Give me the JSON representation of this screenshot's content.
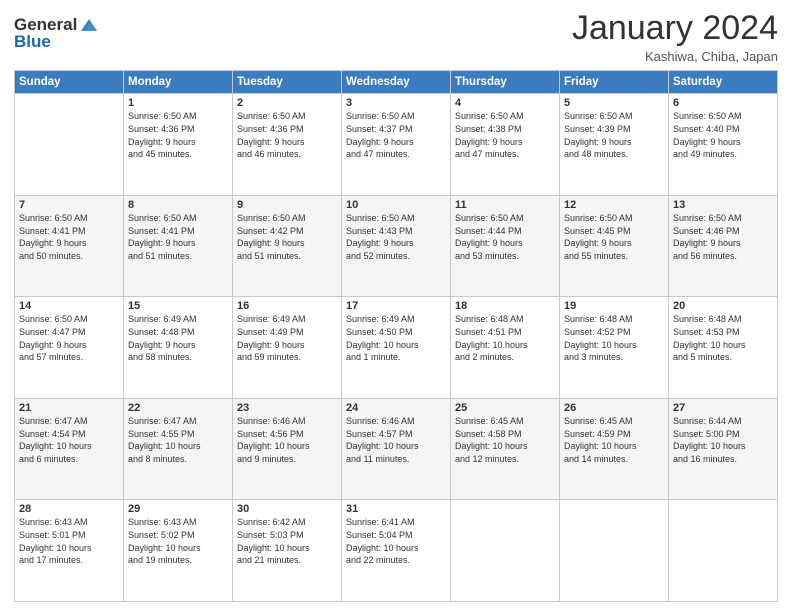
{
  "header": {
    "logo": {
      "general": "General",
      "blue": "Blue"
    },
    "title": "January 2024",
    "location": "Kashiwa, Chiba, Japan"
  },
  "days_of_week": [
    "Sunday",
    "Monday",
    "Tuesday",
    "Wednesday",
    "Thursday",
    "Friday",
    "Saturday"
  ],
  "weeks": [
    [
      {
        "day": "",
        "info": ""
      },
      {
        "day": "1",
        "info": "Sunrise: 6:50 AM\nSunset: 4:36 PM\nDaylight: 9 hours\nand 45 minutes."
      },
      {
        "day": "2",
        "info": "Sunrise: 6:50 AM\nSunset: 4:36 PM\nDaylight: 9 hours\nand 46 minutes."
      },
      {
        "day": "3",
        "info": "Sunrise: 6:50 AM\nSunset: 4:37 PM\nDaylight: 9 hours\nand 47 minutes."
      },
      {
        "day": "4",
        "info": "Sunrise: 6:50 AM\nSunset: 4:38 PM\nDaylight: 9 hours\nand 47 minutes."
      },
      {
        "day": "5",
        "info": "Sunrise: 6:50 AM\nSunset: 4:39 PM\nDaylight: 9 hours\nand 48 minutes."
      },
      {
        "day": "6",
        "info": "Sunrise: 6:50 AM\nSunset: 4:40 PM\nDaylight: 9 hours\nand 49 minutes."
      }
    ],
    [
      {
        "day": "7",
        "info": ""
      },
      {
        "day": "8",
        "info": "Sunrise: 6:50 AM\nSunset: 4:41 PM\nDaylight: 9 hours\nand 51 minutes."
      },
      {
        "day": "9",
        "info": "Sunrise: 6:50 AM\nSunset: 4:42 PM\nDaylight: 9 hours\nand 51 minutes."
      },
      {
        "day": "10",
        "info": "Sunrise: 6:50 AM\nSunset: 4:43 PM\nDaylight: 9 hours\nand 52 minutes."
      },
      {
        "day": "11",
        "info": "Sunrise: 6:50 AM\nSunset: 4:44 PM\nDaylight: 9 hours\nand 53 minutes."
      },
      {
        "day": "12",
        "info": "Sunrise: 6:50 AM\nSunset: 4:45 PM\nDaylight: 9 hours\nand 55 minutes."
      },
      {
        "day": "13",
        "info": "Sunrise: 6:50 AM\nSunset: 4:46 PM\nDaylight: 9 hours\nand 56 minutes."
      }
    ],
    [
      {
        "day": "14",
        "info": ""
      },
      {
        "day": "15",
        "info": "Sunrise: 6:49 AM\nSunset: 4:48 PM\nDaylight: 9 hours\nand 58 minutes."
      },
      {
        "day": "16",
        "info": "Sunrise: 6:49 AM\nSunset: 4:49 PM\nDaylight: 9 hours\nand 59 minutes."
      },
      {
        "day": "17",
        "info": "Sunrise: 6:49 AM\nSunset: 4:50 PM\nDaylight: 10 hours\nand 1 minute."
      },
      {
        "day": "18",
        "info": "Sunrise: 6:48 AM\nSunset: 4:51 PM\nDaylight: 10 hours\nand 2 minutes."
      },
      {
        "day": "19",
        "info": "Sunrise: 6:48 AM\nSunset: 4:52 PM\nDaylight: 10 hours\nand 3 minutes."
      },
      {
        "day": "20",
        "info": "Sunrise: 6:48 AM\nSunset: 4:53 PM\nDaylight: 10 hours\nand 5 minutes."
      }
    ],
    [
      {
        "day": "21",
        "info": ""
      },
      {
        "day": "22",
        "info": "Sunrise: 6:47 AM\nSunset: 4:55 PM\nDaylight: 10 hours\nand 8 minutes."
      },
      {
        "day": "23",
        "info": "Sunrise: 6:46 AM\nSunset: 4:56 PM\nDaylight: 10 hours\nand 9 minutes."
      },
      {
        "day": "24",
        "info": "Sunrise: 6:46 AM\nSunset: 4:57 PM\nDaylight: 10 hours\nand 11 minutes."
      },
      {
        "day": "25",
        "info": "Sunrise: 6:45 AM\nSunset: 4:58 PM\nDaylight: 10 hours\nand 12 minutes."
      },
      {
        "day": "26",
        "info": "Sunrise: 6:45 AM\nSunset: 4:59 PM\nDaylight: 10 hours\nand 14 minutes."
      },
      {
        "day": "27",
        "info": "Sunrise: 6:44 AM\nSunset: 5:00 PM\nDaylight: 10 hours\nand 16 minutes."
      }
    ],
    [
      {
        "day": "28",
        "info": ""
      },
      {
        "day": "29",
        "info": "Sunrise: 6:43 AM\nSunset: 5:02 PM\nDaylight: 10 hours\nand 19 minutes."
      },
      {
        "day": "30",
        "info": "Sunrise: 6:42 AM\nSunset: 5:03 PM\nDaylight: 10 hours\nand 21 minutes."
      },
      {
        "day": "31",
        "info": "Sunrise: 6:41 AM\nSunset: 5:04 PM\nDaylight: 10 hours\nand 22 minutes."
      },
      {
        "day": "",
        "info": ""
      },
      {
        "day": "",
        "info": ""
      },
      {
        "day": "",
        "info": ""
      }
    ]
  ],
  "week1_day7_info": "Sunrise: 6:50 AM\nSunset: 4:41 PM\nDaylight: 9 hours\nand 50 minutes.",
  "week2_day1_info": "Sunrise: 6:50 AM\nSunset: 4:47 PM\nDaylight: 9 hours\nand 57 minutes.",
  "week3_day1_info": "Sunrise: 6:50 AM\nSunset: 4:47 PM\nDaylight: 9 hours\nand 57 minutes.",
  "week4_day1_info": "Sunrise: 6:47 AM\nSunset: 4:54 PM\nDaylight: 10 hours\nand 6 minutes.",
  "week5_day1_info": "Sunrise: 6:43 AM\nSunset: 5:01 PM\nDaylight: 10 hours\nand 17 minutes."
}
